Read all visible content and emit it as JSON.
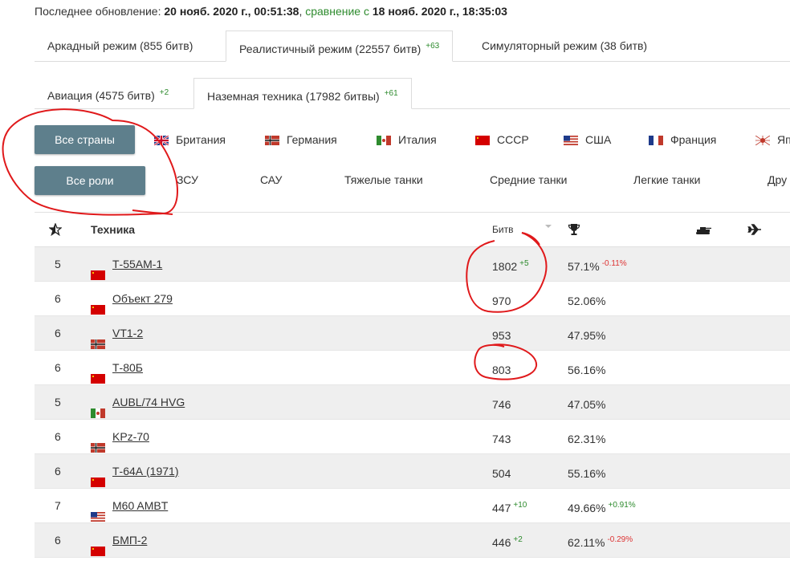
{
  "header": {
    "update_label": "Последнее обновление:",
    "update_date": "20 нояб. 2020 г., 00:51:38",
    "compare_label": "сравнение с",
    "compare_date": "18 нояб. 2020 г., 18:35:03"
  },
  "mode_tabs": [
    {
      "label": "Аркадный режим (855 битв)",
      "delta": ""
    },
    {
      "label": "Реалистичный режим (22557 битв)",
      "delta": "+63"
    },
    {
      "label": "Симуляторный режим (38 битв)",
      "delta": ""
    }
  ],
  "type_tabs": [
    {
      "label": "Авиация (4575 битв)",
      "delta": "+2"
    },
    {
      "label": "Наземная техника (17982 битвы)",
      "delta": "+61"
    }
  ],
  "filters": {
    "countries_button": "Все страны",
    "roles_button": "Все роли",
    "countries": [
      "Британия",
      "Германия",
      "Италия",
      "СССР",
      "США",
      "Франция",
      "Яп"
    ],
    "roles": [
      "ЗСУ",
      "САУ",
      "Тяжелые танки",
      "Средние танки",
      "Легкие танки",
      "Дру"
    ]
  },
  "table": {
    "columns": {
      "vehicle": "Техника",
      "battles": "Битв"
    },
    "header_icons": [
      "star-icon",
      "trophy-icon",
      "tank-icon",
      "plane-icon"
    ],
    "rows": [
      {
        "br": "5",
        "country": "ussr",
        "vehicle": "Т-55АМ-1",
        "battles": "1802",
        "battles_delta": "+5",
        "winrate": "57.1%",
        "winrate_delta": "-0.11%"
      },
      {
        "br": "6",
        "country": "ussr",
        "vehicle": "Объект 279",
        "battles": "970",
        "battles_delta": "",
        "winrate": "52.06%",
        "winrate_delta": ""
      },
      {
        "br": "6",
        "country": "germany",
        "vehicle": "VT1-2",
        "battles": "953",
        "battles_delta": "",
        "winrate": "47.95%",
        "winrate_delta": ""
      },
      {
        "br": "6",
        "country": "ussr",
        "vehicle": "Т-80Б",
        "battles": "803",
        "battles_delta": "",
        "winrate": "56.16%",
        "winrate_delta": ""
      },
      {
        "br": "5",
        "country": "italy",
        "vehicle": "AUBL/74 HVG",
        "battles": "746",
        "battles_delta": "",
        "winrate": "47.05%",
        "winrate_delta": ""
      },
      {
        "br": "6",
        "country": "germany",
        "vehicle": "KPz-70",
        "battles": "743",
        "battles_delta": "",
        "winrate": "62.31%",
        "winrate_delta": ""
      },
      {
        "br": "6",
        "country": "ussr",
        "vehicle": "Т-64А (1971)",
        "battles": "504",
        "battles_delta": "",
        "winrate": "55.16%",
        "winrate_delta": ""
      },
      {
        "br": "7",
        "country": "usa",
        "vehicle": "M60 AMBT",
        "battles": "447",
        "battles_delta": "+10",
        "winrate": "49.66%",
        "winrate_delta": "+0.91%"
      },
      {
        "br": "6",
        "country": "ussr",
        "vehicle": "БМП-2",
        "battles": "446",
        "battles_delta": "+2",
        "winrate": "62.11%",
        "winrate_delta": "-0.29%"
      }
    ]
  },
  "colors": {
    "button_bg": "#5e7f8c",
    "positive": "#2e8b2e",
    "negative": "#dd3333",
    "annotation": "#e0191b",
    "row_alt": "#efefef"
  }
}
